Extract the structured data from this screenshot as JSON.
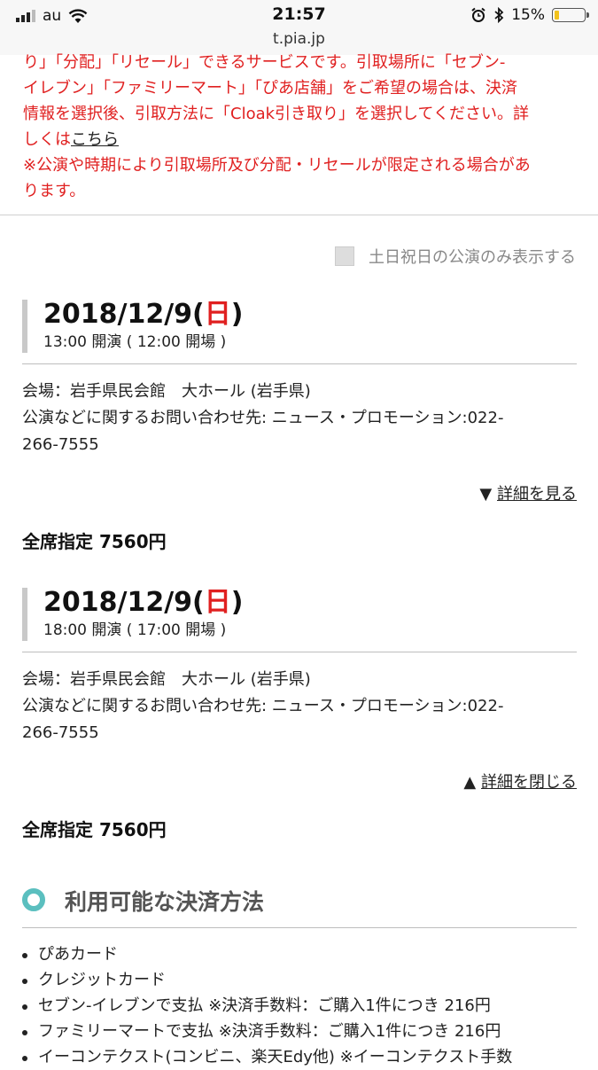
{
  "status_bar": {
    "carrier": "au",
    "time": "21:57",
    "battery_percent_label": "15%",
    "battery_level": 0.15,
    "icons": [
      "signal-icon",
      "wifi-icon",
      "alarm-icon",
      "bluetooth-icon",
      "battery-icon"
    ]
  },
  "browser": {
    "url": "t.pia.jp"
  },
  "notice": {
    "line1": "り」「分配」「リセール」できるサービスです。引取場所に「セブン-",
    "line2": "イレブン」「ファミリーマート」「ぴあ店舗」をご希望の場合は、決済",
    "line3": "情報を選択後、引取方法に「Cloak引き取り」を選択してください。詳",
    "line4_prefix": "しくは",
    "line4_link": "こちら",
    "line5": "※公演や時期により引取場所及び分配・リセールが限定される場合があ",
    "line6": "ります。",
    "color": "#e02020"
  },
  "filter": {
    "weekend_only_label": "土日祝日の公演のみ表示する",
    "checked": false
  },
  "performances": [
    {
      "date": "2018/12/9(",
      "dow": "日",
      "date_close": ")",
      "time": "13:00 開演 ( 12:00 開場 )",
      "venue": "会場：岩手県民会館　大ホール (岩手県)",
      "contact_line1": "公演などに関するお問い合わせ先: ニュース・プロモーション:022-",
      "contact_line2": "266-7555",
      "toggle_symbol": "▼",
      "toggle_label": "詳細を見る",
      "price": "全席指定 7560円"
    },
    {
      "date": "2018/12/9(",
      "dow": "日",
      "date_close": ")",
      "time": "18:00 開演 ( 17:00 開場 )",
      "venue": "会場：岩手県民会館　大ホール (岩手県)",
      "contact_line1": "公演などに関するお問い合わせ先: ニュース・プロモーション:022-",
      "contact_line2": "266-7555",
      "toggle_symbol": "▲",
      "toggle_label": "詳細を閉じる",
      "price": "全席指定 7560円"
    }
  ],
  "payment": {
    "title": "利用可能な決済方法",
    "accent_color": "#5bbfbf",
    "methods": [
      "ぴあカード",
      "クレジットカード",
      "セブン-イレブンで支払 ※決済手数料：ご購入1件につき 216円",
      "ファミリーマートで支払 ※決済手数料：ご購入1件につき 216円",
      "イーコンテクスト(コンビニ、楽天Edy他) ※イーコンテクスト手数"
    ]
  }
}
